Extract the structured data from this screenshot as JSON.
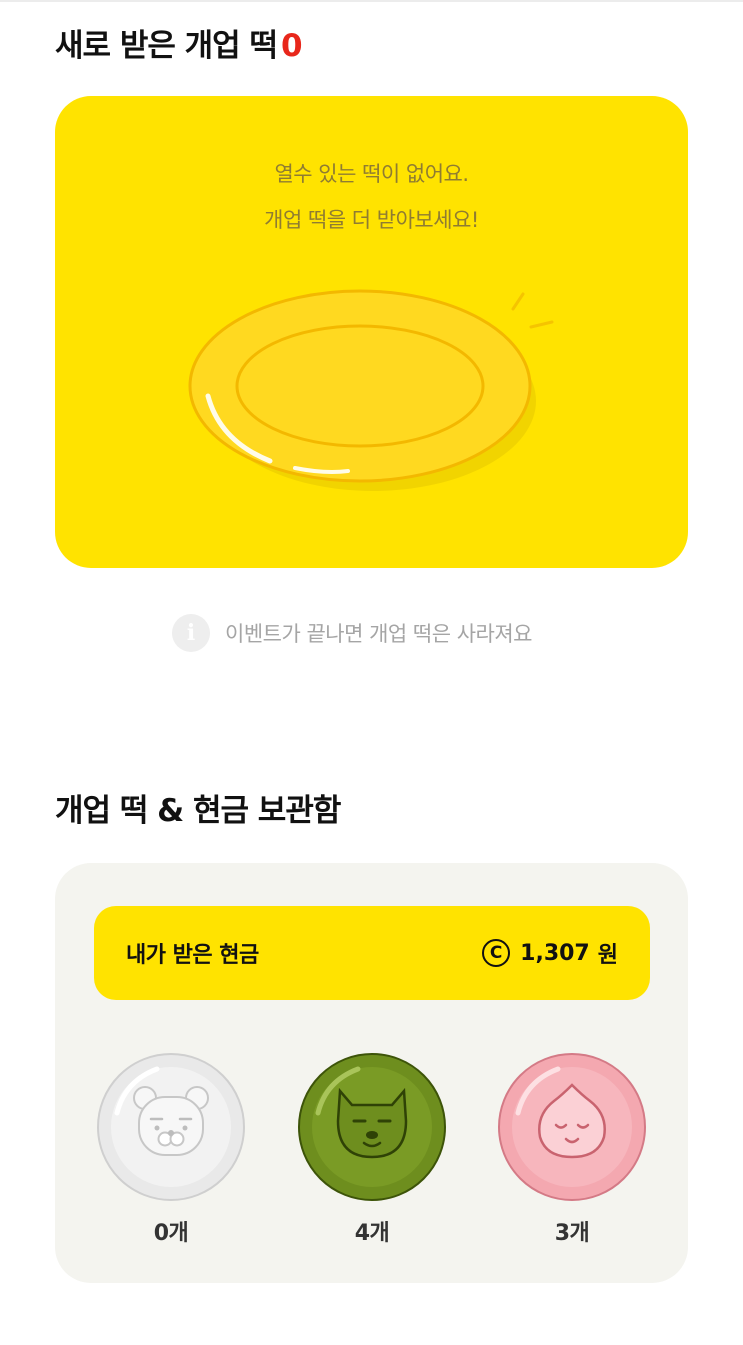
{
  "new_section": {
    "title": "새로 받은 개업 떡",
    "count": "0"
  },
  "empty_card": {
    "line1": "열수 있는 떡이 없어요.",
    "line2": "개업 떡을 더 받아보세요!"
  },
  "notice": {
    "icon": "info-icon",
    "icon_glyph": "i",
    "text": "이벤트가 끝나면 개업 떡은 사라져요"
  },
  "storage_section": {
    "title": "개업 떡 & 현금 보관함"
  },
  "cash": {
    "label": "내가 받은 현금",
    "icon_glyph": "C",
    "amount": "1,307",
    "unit": "원"
  },
  "rice_cakes": [
    {
      "character": "ryan",
      "color": "white",
      "count_label": "0개"
    },
    {
      "character": "muzi-cat",
      "color": "green",
      "count_label": "4개"
    },
    {
      "character": "apeach",
      "color": "pink",
      "count_label": "3개"
    }
  ],
  "colors": {
    "accent_yellow": "#ffe300",
    "count_red": "#e8271b",
    "storage_bg": "#f4f4ef"
  }
}
